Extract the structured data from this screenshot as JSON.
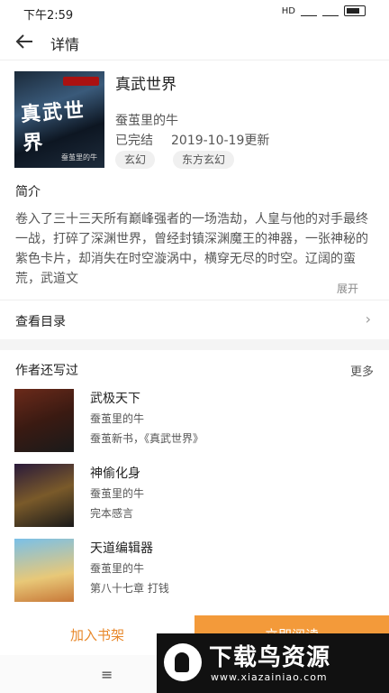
{
  "status_bar": {
    "time": "下午2:59",
    "network": "HD",
    "battery": "battery"
  },
  "header": {
    "title": "详情"
  },
  "book": {
    "cover_title": "真武世界",
    "cover_author": "蚕茧里的牛",
    "title": "真武世界",
    "author": "蚕茧里的牛",
    "status": "已完结",
    "updated": "2019-10-19更新",
    "tags": [
      "玄幻",
      "东方玄幻"
    ]
  },
  "intro": {
    "label": "简介",
    "text": "卷入了三十三天所有巅峰强者的一场浩劫，人皇与他的对手最终一战，打碎了深渊世界，曾经封镇深渊魔王的神器，一张神秘的紫色卡片，却消失在时空漩涡中，横穿无尽的时空。辽阔的蛮荒，武道文",
    "expand": "展开"
  },
  "catalog": {
    "label": "查看目录",
    "arrow": "›"
  },
  "also_wrote": {
    "label": "作者还写过",
    "more": "更多",
    "books": [
      {
        "title": "武极天下",
        "author": "蚕茧里的牛",
        "latest": "蚕茧新书，《真武世界》",
        "cover_text": "武极天下"
      },
      {
        "title": "神偷化身",
        "author": "蚕茧里的牛",
        "latest": "完本感言",
        "cover_text": "神偷化身"
      },
      {
        "title": "天道编辑器",
        "author": "蚕茧里的牛",
        "latest": "第八十七章 打钱",
        "cover_text": "天道编辑器"
      }
    ]
  },
  "bottom": {
    "add_shelf": "加入书架",
    "read_now": "立即阅读"
  },
  "nav": {
    "menu": "≡"
  },
  "watermark": {
    "brand": "下载鸟资源",
    "url": "www.xiazainiao.com"
  },
  "colors": {
    "accent": "#f39a3a",
    "accent_text": "#e8882b"
  }
}
